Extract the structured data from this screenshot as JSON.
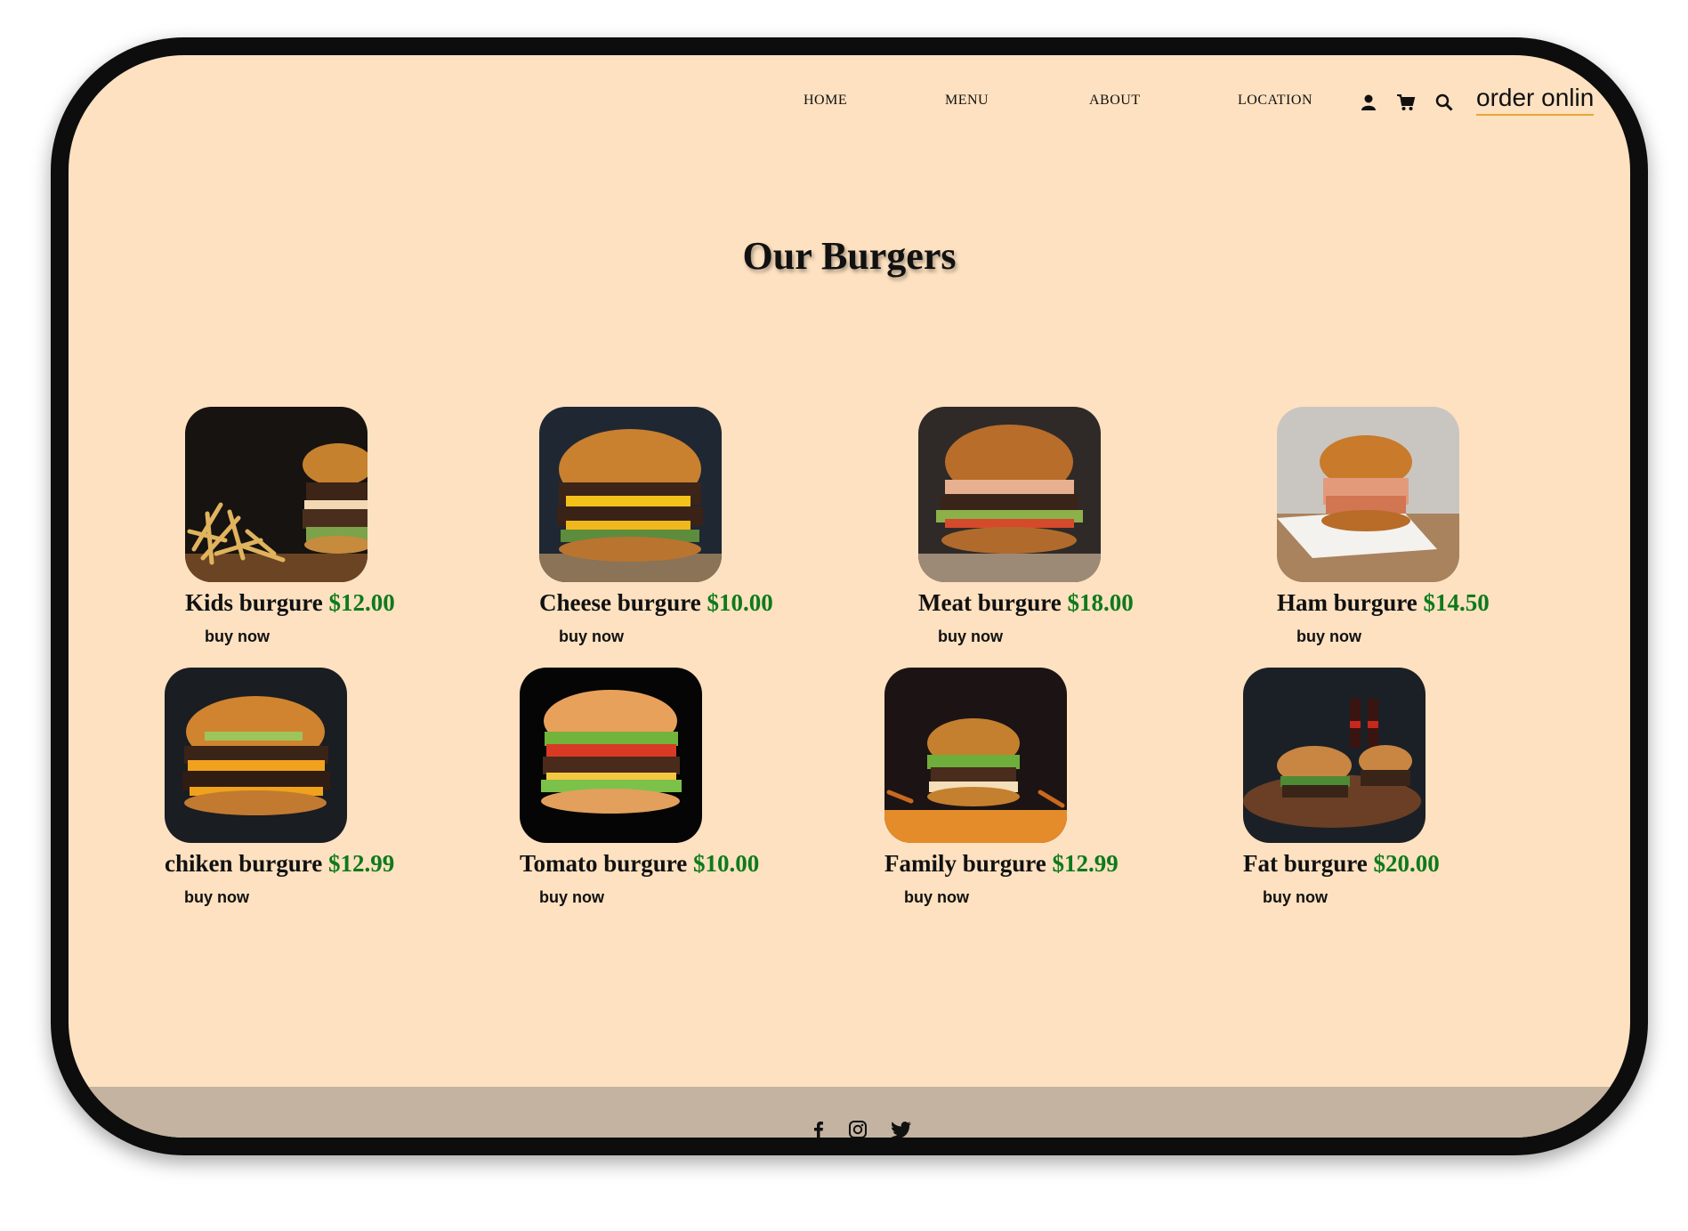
{
  "nav": {
    "links": [
      "HOME",
      "MENU",
      "ABOUT",
      "LOCATION"
    ],
    "icons": [
      "user-icon",
      "cart-icon",
      "search-icon"
    ],
    "order_label": "order onlin"
  },
  "page_title": "Our Burgers",
  "colors": {
    "background": "#fde1c0",
    "price": "#0d7a1c",
    "footer": "#c3b3a0",
    "order_underline": "#e8a73a"
  },
  "products": [
    {
      "name": "Kids burgure",
      "price": "$12.00",
      "button": "buy now"
    },
    {
      "name": "Cheese burgure",
      "price": "$10.00",
      "button": "buy now"
    },
    {
      "name": "Meat burgure",
      "price": "$18.00",
      "button": "buy now"
    },
    {
      "name": "Ham burgure",
      "price": "$14.50",
      "button": "buy now"
    },
    {
      "name": "chiken burgure",
      "price": "$12.99",
      "button": "buy now"
    },
    {
      "name": "Tomato burgure",
      "price": "$10.00",
      "button": "buy now"
    },
    {
      "name": "Family burgure",
      "price": "$12.99",
      "button": "buy now"
    },
    {
      "name": "Fat burgure",
      "price": "$20.00",
      "button": "buy now"
    }
  ],
  "footer": {
    "social": [
      "facebook-icon",
      "instagram-icon",
      "twitter-icon"
    ]
  }
}
